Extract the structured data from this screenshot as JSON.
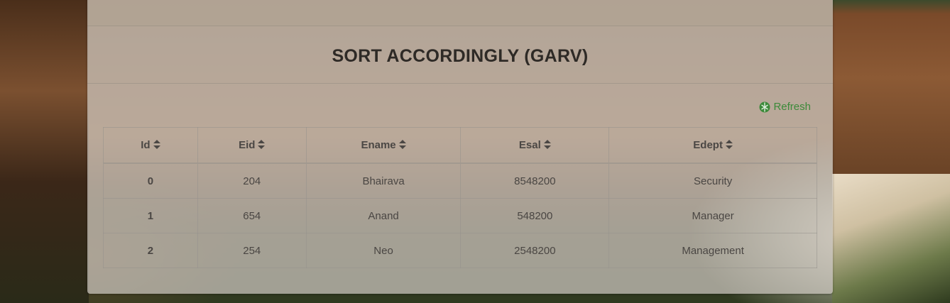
{
  "page": {
    "title": "SORT ACCORDINGLY (GARV)"
  },
  "toolbar": {
    "refresh_label": "Refresh",
    "refresh_icon": "refresh-icon",
    "refresh_color": "#3c8a3a"
  },
  "table": {
    "columns": [
      {
        "label": "Id",
        "icon": "sort-icon"
      },
      {
        "label": "Eid",
        "icon": "sort-icon"
      },
      {
        "label": "Ename",
        "icon": "sort-icon"
      },
      {
        "label": "Esal",
        "icon": "sort-icon"
      },
      {
        "label": "Edept",
        "icon": "sort-icon"
      }
    ],
    "rows": [
      [
        "0",
        "204",
        "Bhairava",
        "8548200",
        "Security"
      ],
      [
        "1",
        "654",
        "Anand",
        "548200",
        "Manager"
      ],
      [
        "2",
        "254",
        "Neo",
        "2548200",
        "Management"
      ]
    ]
  }
}
